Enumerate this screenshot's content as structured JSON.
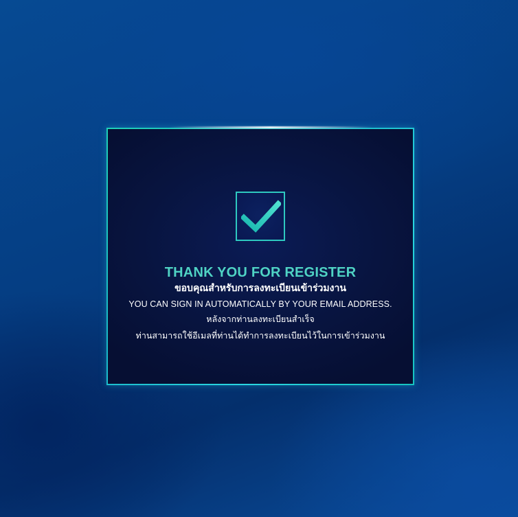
{
  "dialog": {
    "title": "THANK YOU FOR REGISTER",
    "subtitle_th": "ขอบคุณสำหรับการลงทะเบียนเข้าร่วมงาน",
    "message_en": "YOU CAN SIGN IN AUTOMATICALLY BY YOUR EMAIL ADDRESS.",
    "message_th_1": "หลังจากท่านลงทะเบียนสำเร็จ",
    "message_th_2": "ท่านสามารถใช้อีเมลที่ท่านได้ทำการลงทะเบียนไว้ในการเข้าร่วมงาน",
    "icon": "checkmark-icon"
  },
  "colors": {
    "background": "#053d82",
    "panel": "#08143f",
    "accent": "#4fd3c4",
    "border": "#1fd0b8"
  }
}
